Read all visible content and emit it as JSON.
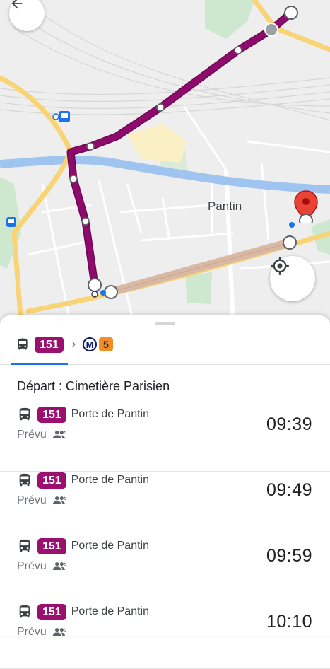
{
  "map": {
    "place_label": "Pantin",
    "colors": {
      "route_bus": "#8e0b6b",
      "route_walk": "#d9b9a3",
      "water": "#9fc4ef",
      "major_road": "#f8d477",
      "park": "#cde8cf"
    }
  },
  "header": {
    "back_icon": "arrow-left-icon"
  },
  "controls": {
    "locate_icon": "my-location-icon"
  },
  "tabs": {
    "bus_line": "151",
    "chevron": "›",
    "metro_symbol": "M",
    "metro_line": "5"
  },
  "departures": {
    "title": "Départ : Cimetière Parisien",
    "rows": [
      {
        "line": "151",
        "destination": "Porte de Pantin",
        "status": "Prévu",
        "time": "09:39"
      },
      {
        "line": "151",
        "destination": "Porte de Pantin",
        "status": "Prévu",
        "time": "09:49"
      },
      {
        "line": "151",
        "destination": "Porte de Pantin",
        "status": "Prévu",
        "time": "09:59"
      },
      {
        "line": "151",
        "destination": "Porte de Pantin",
        "status": "Prévu",
        "time": "10:10"
      }
    ]
  }
}
